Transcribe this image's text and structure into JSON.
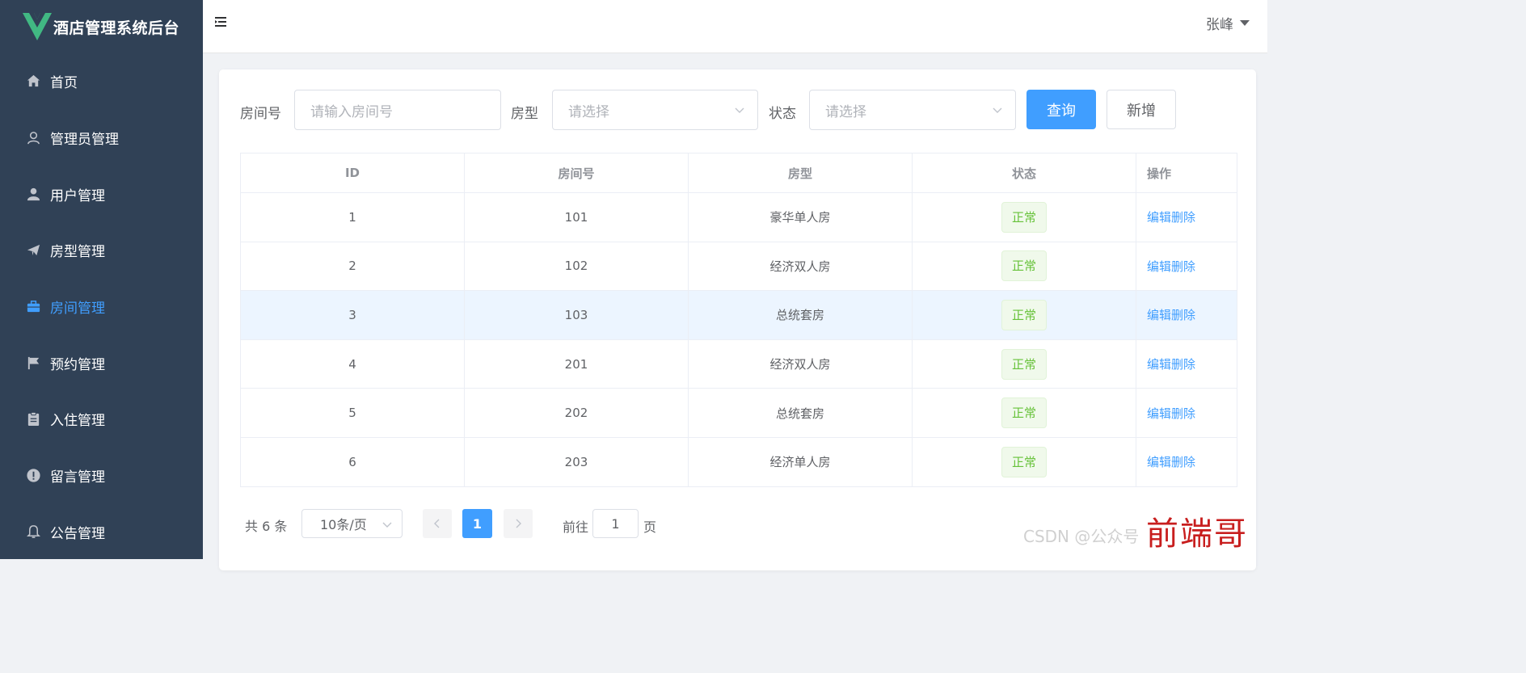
{
  "app": {
    "title": "酒店管理系统后台"
  },
  "sidebar": {
    "items": [
      {
        "label": "首页",
        "icon": "home-icon"
      },
      {
        "label": "管理员管理",
        "icon": "user-outline-icon"
      },
      {
        "label": "用户管理",
        "icon": "user-solid-icon"
      },
      {
        "label": "房型管理",
        "icon": "paper-plane-icon"
      },
      {
        "label": "房间管理",
        "icon": "briefcase-icon",
        "active": true
      },
      {
        "label": "预约管理",
        "icon": "flag-icon"
      },
      {
        "label": "入住管理",
        "icon": "clipboard-icon"
      },
      {
        "label": "留言管理",
        "icon": "warning-circle-icon"
      },
      {
        "label": "公告管理",
        "icon": "bell-icon"
      }
    ]
  },
  "header": {
    "user_name": "张峰"
  },
  "filters": {
    "room_no_label": "房间号",
    "room_no_placeholder": "请输入房间号",
    "room_type_label": "房型",
    "room_type_placeholder": "请选择",
    "status_label": "状态",
    "status_placeholder": "请选择",
    "query_button": "查询",
    "add_button": "新增"
  },
  "table": {
    "columns": [
      "ID",
      "房间号",
      "房型",
      "状态",
      "操作"
    ],
    "rows": [
      {
        "id": "1",
        "room_no": "101",
        "room_type": "豪华单人房",
        "status": "正常"
      },
      {
        "id": "2",
        "room_no": "102",
        "room_type": "经济双人房",
        "status": "正常"
      },
      {
        "id": "3",
        "room_no": "103",
        "room_type": "总统套房",
        "status": "正常"
      },
      {
        "id": "4",
        "room_no": "201",
        "room_type": "经济双人房",
        "status": "正常"
      },
      {
        "id": "5",
        "room_no": "202",
        "room_type": "总统套房",
        "status": "正常"
      },
      {
        "id": "6",
        "room_no": "203",
        "room_type": "经济单人房",
        "status": "正常"
      }
    ],
    "edit_label": "编辑",
    "delete_label": "删除"
  },
  "pagination": {
    "total_text": "共 6 条",
    "page_size": "10条/页",
    "current_page": "1",
    "goto_label": "前往",
    "goto_value": "1",
    "page_suffix": "页"
  },
  "watermark": {
    "text": "CSDN @公众号",
    "red_text": "前端哥"
  },
  "colors": {
    "sidebar_bg": "#304156",
    "primary": "#409eff",
    "success": "#67c23a",
    "logo_green": "#41b883"
  }
}
